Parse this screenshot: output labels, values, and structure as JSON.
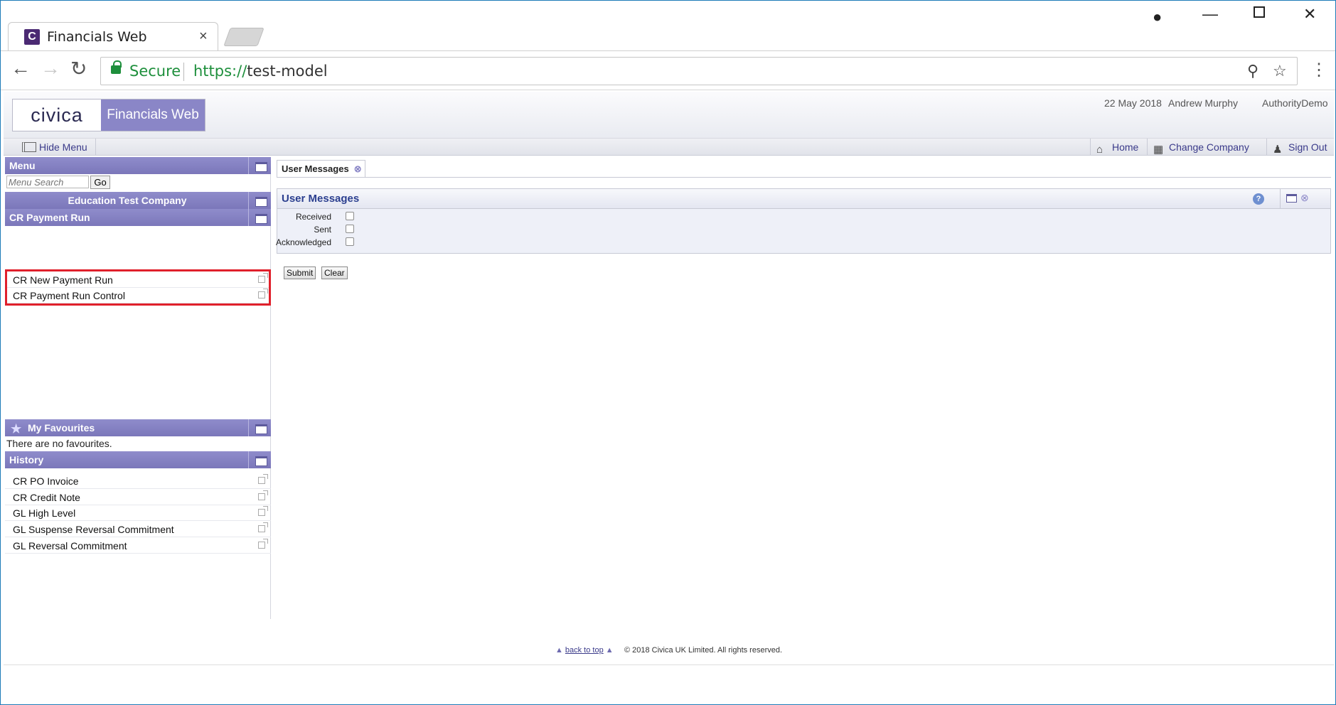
{
  "browser": {
    "tab_title": "Financials Web",
    "tab_close": "×",
    "secure_label": "Secure",
    "url_scheme": "https://",
    "url_host": "test-model"
  },
  "app": {
    "logo_text": "civica",
    "product_name": "Financials Web",
    "date": "22 May 2018",
    "user": "Andrew Murphy",
    "authority": "AuthorityDemo",
    "hide_menu": "Hide Menu",
    "top_links": {
      "home": "Home",
      "change_company": "Change Company",
      "sign_out": "Sign Out"
    }
  },
  "sidebar": {
    "menu_title": "Menu",
    "search_placeholder": "Menu Search",
    "go_label": "Go",
    "company": "Education Test Company",
    "section_title": "CR Payment Run",
    "section_items": [
      "CR New Payment Run",
      "CR Payment Run Control"
    ],
    "favourites_title": "My Favourites",
    "favourites_empty": "There are no favourites.",
    "history_title": "History",
    "history_items": [
      "CR PO Invoice",
      "CR Credit Note",
      "GL High Level",
      "GL Suspense Reversal Commitment",
      "GL Reversal Commitment"
    ]
  },
  "content": {
    "tab_label": "User Messages",
    "box_title": "User Messages",
    "fields": {
      "received": "Received",
      "sent": "Sent",
      "acknowledged": "Acknowledged"
    },
    "submit": "Submit",
    "clear": "Clear"
  },
  "footer": {
    "back_to_top": "back to top",
    "copyright": "© 2018 Civica UK Limited. All rights reserved."
  },
  "colors": {
    "accent": "#8a86c7",
    "highlight": "#e0202b",
    "secure_green": "#1e8f3c"
  }
}
